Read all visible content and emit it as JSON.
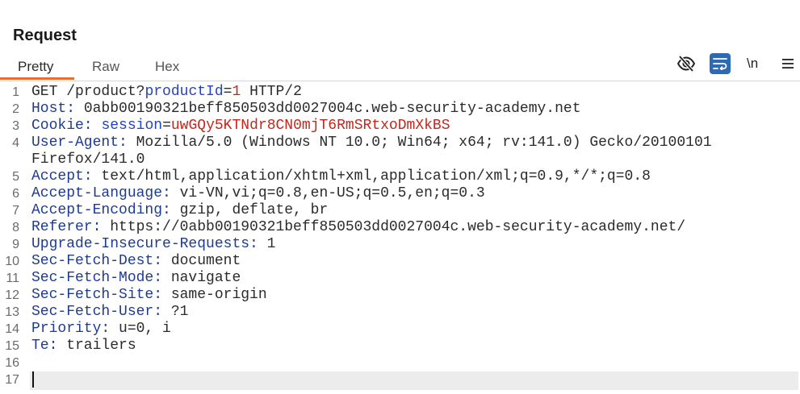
{
  "panel": {
    "title": "Request"
  },
  "tabs": [
    {
      "label": "Pretty",
      "active": true
    },
    {
      "label": "Raw",
      "active": false
    },
    {
      "label": "Hex",
      "active": false
    }
  ],
  "toolbar": {
    "hide_icon": "eye-slash-icon",
    "wrap_icon": "text-wrap-icon",
    "wrap_active": true,
    "newlines_label": "\\n",
    "menu_icon": "hamburger-menu-icon"
  },
  "colors": {
    "accent": "#e8702e",
    "wrap_button": "#2d6ab4",
    "name": "#1d3c8f",
    "plain": "#2b2b2b",
    "param": "#2343c2",
    "pval": "#c4261d"
  },
  "editor": {
    "lines": [
      {
        "n": 1,
        "tokens": [
          {
            "t": "GET /product?",
            "k": "plain"
          },
          {
            "t": "productId",
            "k": "param"
          },
          {
            "t": "=",
            "k": "plain"
          },
          {
            "t": "1",
            "k": "pval"
          },
          {
            "t": " HTTP/2",
            "k": "plain"
          }
        ]
      },
      {
        "n": 2,
        "tokens": [
          {
            "t": "Host:",
            "k": "name"
          },
          {
            "t": " 0abb00190321beff850503dd0027004c.web-security-academy.net",
            "k": "plain"
          }
        ]
      },
      {
        "n": 3,
        "tokens": [
          {
            "t": "Cookie:",
            "k": "name"
          },
          {
            "t": " ",
            "k": "plain"
          },
          {
            "t": "session",
            "k": "param"
          },
          {
            "t": "=",
            "k": "plain"
          },
          {
            "t": "uwGQy5KTNdr8CN0mjT6RmSRtxoDmXkBS",
            "k": "pval"
          }
        ]
      },
      {
        "n": 4,
        "tokens": [
          {
            "t": "User-Agent:",
            "k": "name"
          },
          {
            "t": " Mozilla/5.0 (Windows NT 10.0; Win64; x64; rv:141.0) Gecko/20100101 Firefox/141.0",
            "k": "plain"
          }
        ]
      },
      {
        "n": 5,
        "tokens": [
          {
            "t": "Accept:",
            "k": "name"
          },
          {
            "t": " text/html,application/xhtml+xml,application/xml;q=0.9,*/*;q=0.8",
            "k": "plain"
          }
        ]
      },
      {
        "n": 6,
        "tokens": [
          {
            "t": "Accept-Language:",
            "k": "name"
          },
          {
            "t": " vi-VN,vi;q=0.8,en-US;q=0.5,en;q=0.3",
            "k": "plain"
          }
        ]
      },
      {
        "n": 7,
        "tokens": [
          {
            "t": "Accept-Encoding:",
            "k": "name"
          },
          {
            "t": " gzip, deflate, br",
            "k": "plain"
          }
        ]
      },
      {
        "n": 8,
        "tokens": [
          {
            "t": "Referer:",
            "k": "name"
          },
          {
            "t": " https://0abb00190321beff850503dd0027004c.web-security-academy.net/",
            "k": "plain"
          }
        ]
      },
      {
        "n": 9,
        "tokens": [
          {
            "t": "Upgrade-Insecure-Requests:",
            "k": "name"
          },
          {
            "t": " 1",
            "k": "plain"
          }
        ]
      },
      {
        "n": 10,
        "tokens": [
          {
            "t": "Sec-Fetch-Dest:",
            "k": "name"
          },
          {
            "t": " document",
            "k": "plain"
          }
        ]
      },
      {
        "n": 11,
        "tokens": [
          {
            "t": "Sec-Fetch-Mode:",
            "k": "name"
          },
          {
            "t": " navigate",
            "k": "plain"
          }
        ]
      },
      {
        "n": 12,
        "tokens": [
          {
            "t": "Sec-Fetch-Site:",
            "k": "name"
          },
          {
            "t": " same-origin",
            "k": "plain"
          }
        ]
      },
      {
        "n": 13,
        "tokens": [
          {
            "t": "Sec-Fetch-User:",
            "k": "name"
          },
          {
            "t": " ?1",
            "k": "plain"
          }
        ]
      },
      {
        "n": 14,
        "tokens": [
          {
            "t": "Priority:",
            "k": "name"
          },
          {
            "t": " u=0, i",
            "k": "plain"
          }
        ]
      },
      {
        "n": 15,
        "tokens": [
          {
            "t": "Te:",
            "k": "name"
          },
          {
            "t": " trailers",
            "k": "plain"
          }
        ]
      },
      {
        "n": 16,
        "tokens": []
      },
      {
        "n": 17,
        "tokens": [],
        "active": true
      }
    ]
  }
}
